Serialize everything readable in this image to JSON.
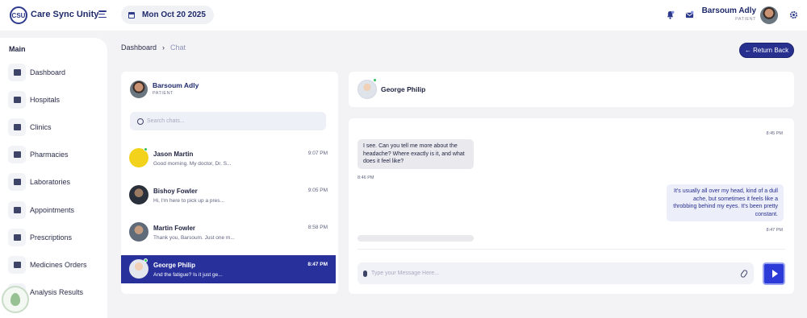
{
  "app": {
    "title": "Care Sync Unity",
    "logo_text": "CSU"
  },
  "topbar": {
    "date": "Mon Oct 20 2025"
  },
  "user": {
    "name": "Barsoum Adly",
    "role": "PATIENT"
  },
  "sidebar": {
    "section": "Main",
    "items": [
      {
        "label": "Dashboard",
        "icon": "dashboard-icon"
      },
      {
        "label": "Hospitals",
        "icon": "hospital-icon"
      },
      {
        "label": "Clinics",
        "icon": "clinic-icon"
      },
      {
        "label": "Pharmacies",
        "icon": "pharmacy-icon"
      },
      {
        "label": "Laboratories",
        "icon": "laboratory-icon"
      },
      {
        "label": "Appointments",
        "icon": "appointments-icon"
      },
      {
        "label": "Prescriptions",
        "icon": "prescriptions-icon"
      },
      {
        "label": "Medicines Orders",
        "icon": "medicine-orders-icon"
      },
      {
        "label": "Analysis Results",
        "icon": "analysis-icon"
      }
    ]
  },
  "breadcrumb": {
    "home": "Dashboard",
    "current": "Chat"
  },
  "return_button": "← Return Back",
  "contacts": {
    "me": {
      "name": "Barsoum Adly",
      "role": "PATIENT"
    },
    "search_placeholder": "Search chats...",
    "chats": [
      {
        "name": "Jason Martin",
        "preview": "Good morning. My doctor, Dr. S...",
        "time": "9:07 PM",
        "avatar_color": "#f2d21a",
        "online": true,
        "active": false
      },
      {
        "name": "Bishoy Fowler",
        "preview": "Hi, I'm here to pick up a pres...",
        "time": "9:05 PM",
        "avatar_color": "#2a2f3c",
        "online": false,
        "active": false
      },
      {
        "name": "Martin Fowler",
        "preview": "Thank you, Barsoum. Just one m...",
        "time": "8:58 PM",
        "avatar_color": "#5f6b78",
        "online": false,
        "active": false
      },
      {
        "name": "George Philip",
        "preview": "And the fatigue? Is it just ge...",
        "time": "8:47 PM",
        "avatar_color": "#e4e7ee",
        "online": true,
        "active": true
      }
    ]
  },
  "chat": {
    "contact_name": "George Philip",
    "messages": [
      {
        "direction": "in",
        "text": "I see. Can you tell me more about the headache? Where exactly is it, and what does it feel like?",
        "time_above": "8:45 PM",
        "time_below": "8:46 PM"
      },
      {
        "direction": "out",
        "text": "It's usually all over my head, kind of a dull ache, but sometimes it feels like a throbbing behind my eyes. It's been pretty constant.",
        "time_below": "8:47 PM"
      }
    ],
    "composer_placeholder": "Type your Message Here..."
  },
  "colors": {
    "accent": "#28308f",
    "send": "#2c3bd8",
    "online": "#2fbf5a"
  }
}
